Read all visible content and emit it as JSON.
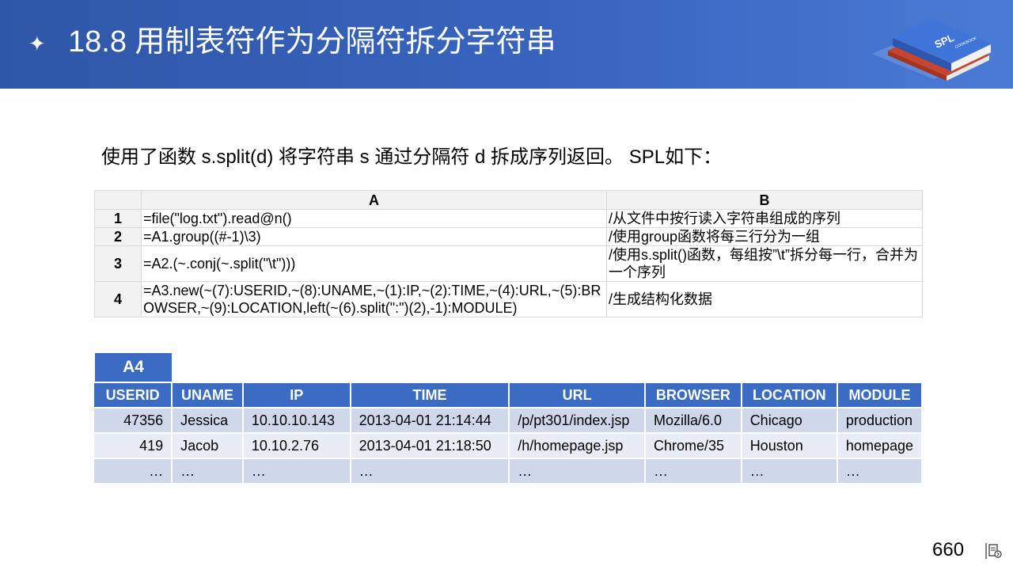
{
  "header": {
    "star_glyph": "✦",
    "title": "18.8  用制表符作为分隔符拆分字符串",
    "logo": {
      "brand": "SPL",
      "sub": "COOKBOOK"
    }
  },
  "intro": "使用了函数 s.split(d) 将字符串 s 通过分隔符 d 拆成序列返回。 SPL如下：",
  "code_table": {
    "columns": [
      "A",
      "B"
    ],
    "rows": [
      {
        "num": "1",
        "a": "=file(\"log.txt\").read@n()",
        "b": "/从文件中按行读入字符串组成的序列"
      },
      {
        "num": "2",
        "a": "=A1.group((#-1)\\3)",
        "b": "/使用group函数将每三行分为一组"
      },
      {
        "num": "3",
        "a": "=A2.(~.conj(~.split(\"\\t\")))",
        "b": "/使用s.split()函数，每组按”\\t”拆分每一行，合并为一个序列"
      },
      {
        "num": "4",
        "a": "=A3.new(~(7):USERID,~(8):UNAME,~(1):IP,~(2):TIME,~(4):URL,~(5):BROWSER,~(9):LOCATION,left(~(6).split(\":\")(2),-1):MODULE)",
        "b": "/生成结构化数据"
      }
    ]
  },
  "result": {
    "tab_label": "A4",
    "columns": [
      "USERID",
      "UNAME",
      "IP",
      "TIME",
      "URL",
      "BROWSER",
      "LOCATION",
      "MODULE"
    ],
    "rows": [
      [
        "47356",
        "Jessica",
        "10.10.10.143",
        "2013-04-01 21:14:44",
        "/p/pt301/index.jsp",
        "Mozilla/6.0",
        "Chicago",
        "production"
      ],
      [
        "419",
        "Jacob",
        "10.10.2.76",
        "2013-04-01 21:18:50",
        "/h/homepage.jsp",
        "Chrome/35",
        "Houston",
        "homepage"
      ],
      [
        "…",
        "…",
        "…",
        "…",
        "…",
        "…",
        "…",
        "…"
      ]
    ]
  },
  "page_number": "660"
}
